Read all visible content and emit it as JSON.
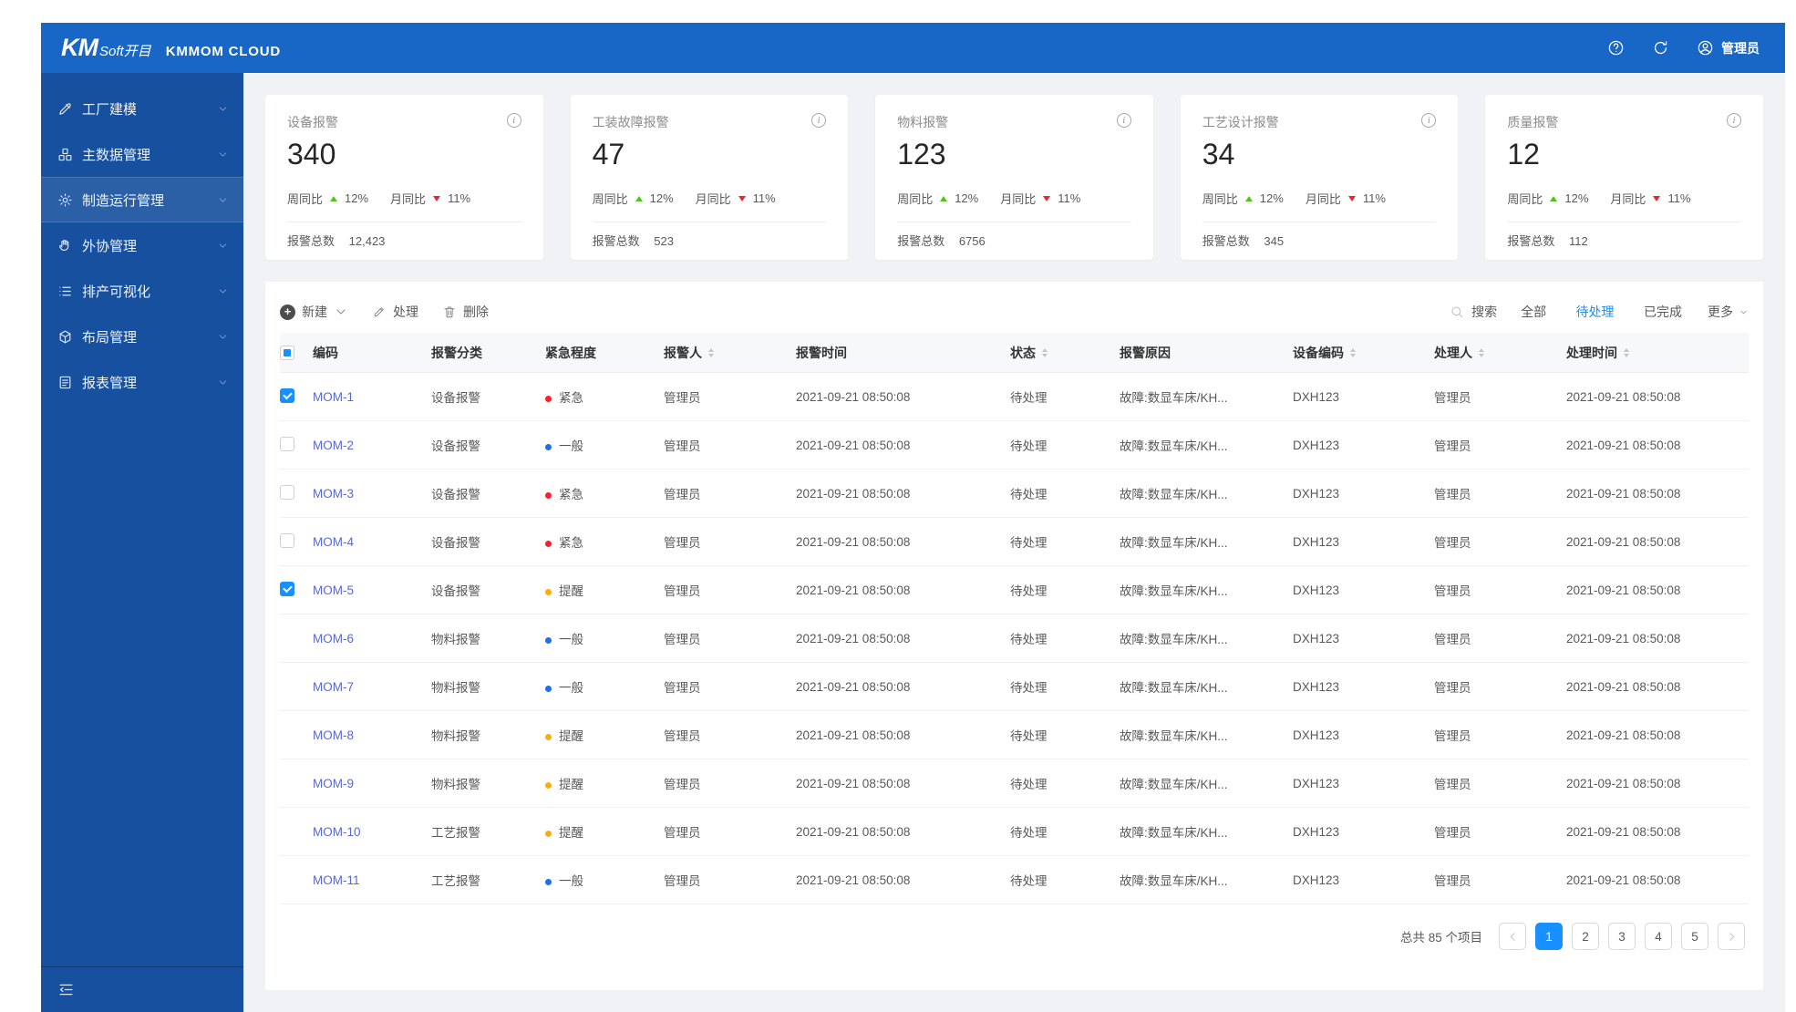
{
  "colors": {
    "accent": "#1890ff",
    "header": "#1866c5",
    "sidebar": "#17509e",
    "logo_yellow": "#f5c518",
    "green": "#52c41a",
    "red": "#f5222d",
    "yellow": "#faad14",
    "blue_dot": "#1f6fe5",
    "link": "#5868d6"
  },
  "header": {
    "logo_km": "KM",
    "logo_soft": "Soft开目",
    "product": "KMMOM CLOUD",
    "user": "管理员"
  },
  "sidebar": {
    "items": [
      {
        "label": "工厂建模",
        "icon": "#i-wrench",
        "active": "false"
      },
      {
        "label": "主数据管理",
        "icon": "#i-blocks",
        "active": "false"
      },
      {
        "label": "制造运行管理",
        "icon": "#i-gear",
        "active": "true"
      },
      {
        "label": "外协管理",
        "icon": "#i-hand",
        "active": "false"
      },
      {
        "label": "排产可视化",
        "icon": "#i-list",
        "active": "false"
      },
      {
        "label": "布局管理",
        "icon": "#i-cube",
        "active": "false"
      },
      {
        "label": "报表管理",
        "icon": "#i-report",
        "active": "false"
      }
    ]
  },
  "cards": [
    {
      "title": "设备报警",
      "value": "340",
      "week_label": "周同比",
      "week": "12%",
      "month_label": "月同比",
      "month": "11%",
      "total_label": "报警总数",
      "total": "12,423"
    },
    {
      "title": "工装故障报警",
      "value": "47",
      "week_label": "周同比",
      "week": "12%",
      "month_label": "月同比",
      "month": "11%",
      "total_label": "报警总数",
      "total": "523"
    },
    {
      "title": "物料报警",
      "value": "123",
      "week_label": "周同比",
      "week": "12%",
      "month_label": "月同比",
      "month": "11%",
      "total_label": "报警总数",
      "total": "6756"
    },
    {
      "title": "工艺设计报警",
      "value": "34",
      "week_label": "周同比",
      "week": "12%",
      "month_label": "月同比",
      "month": "11%",
      "total_label": "报警总数",
      "total": "345"
    },
    {
      "title": "质量报警",
      "value": "12",
      "week_label": "周同比",
      "week": "12%",
      "month_label": "月同比",
      "month": "11%",
      "total_label": "报警总数",
      "total": "112"
    }
  ],
  "toolbar": {
    "new_label": "新建",
    "process_label": "处理",
    "delete_label": "删除",
    "search_label": "搜索",
    "more_label": "更多",
    "filters": [
      {
        "label": "全部",
        "active": "false"
      },
      {
        "label": "待处理",
        "active": "true"
      },
      {
        "label": "已完成",
        "active": "false"
      }
    ]
  },
  "table": {
    "columns": [
      {
        "label": "编码",
        "sortable": "false"
      },
      {
        "label": "报警分类",
        "sortable": "false"
      },
      {
        "label": "紧急程度",
        "sortable": "false"
      },
      {
        "label": "报警人",
        "sortable": "true"
      },
      {
        "label": "报警时间",
        "sortable": "false"
      },
      {
        "label": "状态",
        "sortable": "true"
      },
      {
        "label": "报警原因",
        "sortable": "false"
      },
      {
        "label": "设备编码",
        "sortable": "true"
      },
      {
        "label": "处理人",
        "sortable": "true"
      },
      {
        "label": "处理时间",
        "sortable": "true"
      }
    ],
    "rows": [
      {
        "check": "checked",
        "code": "MOM-1",
        "category": "设备报警",
        "urgency": "紧急",
        "level": "high",
        "reporter": "管理员",
        "time": "2021-09-21 08:50:08",
        "status": "待处理",
        "reason": "故障:数显车床/KH...",
        "device": "DXH123",
        "handler": "管理员",
        "handle_time": "2021-09-21 08:50:08"
      },
      {
        "check": "unchecked",
        "code": "MOM-2",
        "category": "设备报警",
        "urgency": "一般",
        "level": "normal",
        "reporter": "管理员",
        "time": "2021-09-21 08:50:08",
        "status": "待处理",
        "reason": "故障:数显车床/KH...",
        "device": "DXH123",
        "handler": "管理员",
        "handle_time": "2021-09-21 08:50:08"
      },
      {
        "check": "unchecked",
        "code": "MOM-3",
        "category": "设备报警",
        "urgency": "紧急",
        "level": "high",
        "reporter": "管理员",
        "time": "2021-09-21 08:50:08",
        "status": "待处理",
        "reason": "故障:数显车床/KH...",
        "device": "DXH123",
        "handler": "管理员",
        "handle_time": "2021-09-21 08:50:08"
      },
      {
        "check": "unchecked",
        "code": "MOM-4",
        "category": "设备报警",
        "urgency": "紧急",
        "level": "high",
        "reporter": "管理员",
        "time": "2021-09-21 08:50:08",
        "status": "待处理",
        "reason": "故障:数显车床/KH...",
        "device": "DXH123",
        "handler": "管理员",
        "handle_time": "2021-09-21 08:50:08"
      },
      {
        "check": "checked",
        "code": "MOM-5",
        "category": "设备报警",
        "urgency": "提醒",
        "level": "low",
        "reporter": "管理员",
        "time": "2021-09-21 08:50:08",
        "status": "待处理",
        "reason": "故障:数显车床/KH...",
        "device": "DXH123",
        "handler": "管理员",
        "handle_time": "2021-09-21 08:50:08"
      },
      {
        "check": "none",
        "code": "MOM-6",
        "category": "物料报警",
        "urgency": "一般",
        "level": "normal",
        "reporter": "管理员",
        "time": "2021-09-21 08:50:08",
        "status": "待处理",
        "reason": "故障:数显车床/KH...",
        "device": "DXH123",
        "handler": "管理员",
        "handle_time": "2021-09-21 08:50:08"
      },
      {
        "check": "none",
        "code": "MOM-7",
        "category": "物料报警",
        "urgency": "一般",
        "level": "normal",
        "reporter": "管理员",
        "time": "2021-09-21 08:50:08",
        "status": "待处理",
        "reason": "故障:数显车床/KH...",
        "device": "DXH123",
        "handler": "管理员",
        "handle_time": "2021-09-21 08:50:08"
      },
      {
        "check": "none",
        "code": "MOM-8",
        "category": "物料报警",
        "urgency": "提醒",
        "level": "low",
        "reporter": "管理员",
        "time": "2021-09-21 08:50:08",
        "status": "待处理",
        "reason": "故障:数显车床/KH...",
        "device": "DXH123",
        "handler": "管理员",
        "handle_time": "2021-09-21 08:50:08"
      },
      {
        "check": "none",
        "code": "MOM-9",
        "category": "物料报警",
        "urgency": "提醒",
        "level": "low",
        "reporter": "管理员",
        "time": "2021-09-21 08:50:08",
        "status": "待处理",
        "reason": "故障:数显车床/KH...",
        "device": "DXH123",
        "handler": "管理员",
        "handle_time": "2021-09-21 08:50:08"
      },
      {
        "check": "none",
        "code": "MOM-10",
        "category": "工艺报警",
        "urgency": "提醒",
        "level": "low",
        "reporter": "管理员",
        "time": "2021-09-21 08:50:08",
        "status": "待处理",
        "reason": "故障:数显车床/KH...",
        "device": "DXH123",
        "handler": "管理员",
        "handle_time": "2021-09-21 08:50:08"
      },
      {
        "check": "none",
        "code": "MOM-11",
        "category": "工艺报警",
        "urgency": "一般",
        "level": "normal",
        "reporter": "管理员",
        "time": "2021-09-21 08:50:08",
        "status": "待处理",
        "reason": "故障:数显车床/KH...",
        "device": "DXH123",
        "handler": "管理员",
        "handle_time": "2021-09-21 08:50:08"
      }
    ]
  },
  "pagination": {
    "total_label": "总共 85 个项目",
    "pages": [
      {
        "num": "1",
        "active": "true"
      },
      {
        "num": "2",
        "active": "false"
      },
      {
        "num": "3",
        "active": "false"
      },
      {
        "num": "4",
        "active": "false"
      },
      {
        "num": "5",
        "active": "false"
      }
    ]
  }
}
